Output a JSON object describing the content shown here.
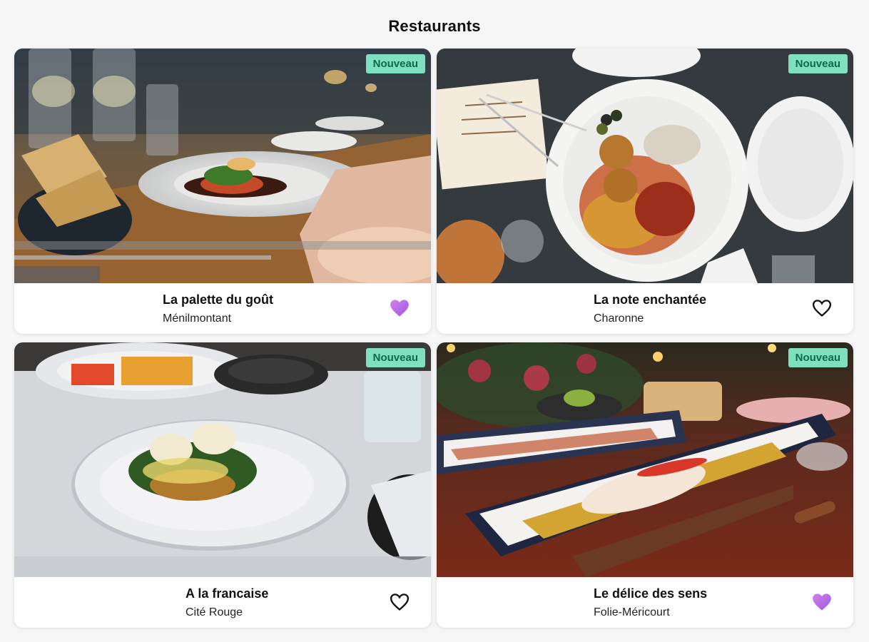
{
  "header": {
    "title": "Restaurants"
  },
  "colors": {
    "badge_bg": "#7fe0c0",
    "badge_text": "#0b6b4a",
    "heart_filled": "#c070e8",
    "heart_outline": "#111111"
  },
  "restaurants": [
    {
      "name": "La palette du goût",
      "district": "Ménilmontant",
      "badge": "Nouveau",
      "favorite": true,
      "heart_icon": "heart-filled-icon"
    },
    {
      "name": "La note enchantée",
      "district": "Charonne",
      "badge": "Nouveau",
      "favorite": false,
      "heart_icon": "heart-outline-icon"
    },
    {
      "name": "A la francaise",
      "district": "Cité Rouge",
      "badge": "Nouveau",
      "favorite": false,
      "heart_icon": "heart-outline-icon"
    },
    {
      "name": "Le délice des sens",
      "district": "Folie-Méricourt",
      "badge": "Nouveau",
      "favorite": true,
      "heart_icon": "heart-filled-icon"
    }
  ]
}
